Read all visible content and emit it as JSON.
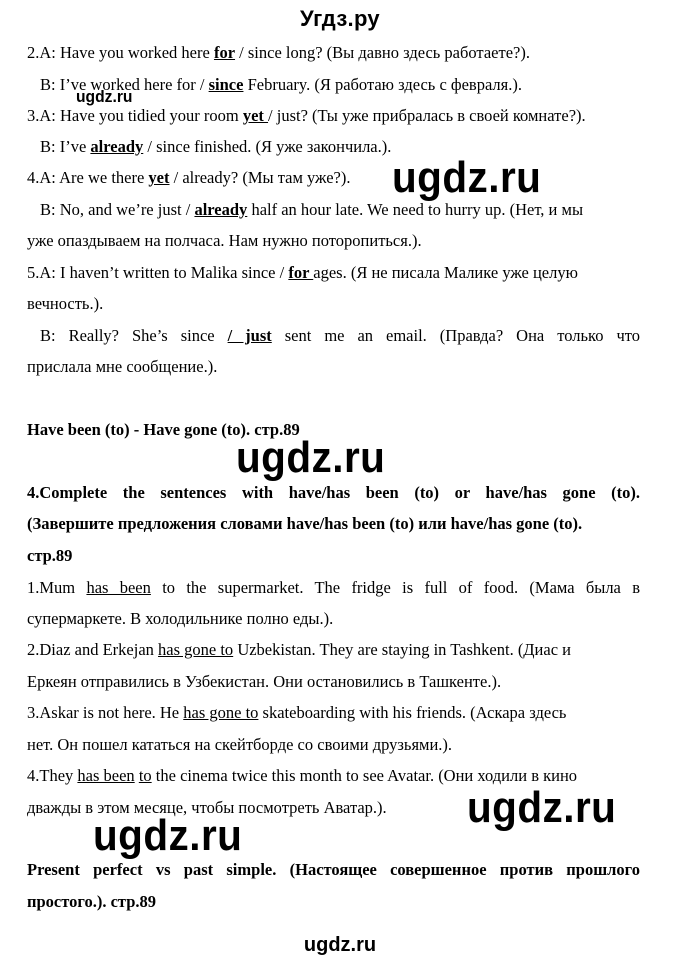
{
  "header": {
    "site_title": "Угдз.ру"
  },
  "exercise3": {
    "items": [
      {
        "a": {
          "prefix": "2.A: Have you worked here ",
          "answer": "for",
          "suffix": " / since long?  (Вы давно здесь работаете?)."
        },
        "b": {
          "prefix": "B: I’ve worked here for / ",
          "answer": "since",
          "suffix": " February. (Я работаю здесь с февраля.)."
        }
      },
      {
        "a": {
          "prefix": "3.A: Have you tidied your room ",
          "answer": "yet ",
          "suffix": "/ just? (Ты уже прибралась в своей комнате?)."
        },
        "b": {
          "prefix": "B: I’ve ",
          "answer": "already",
          "suffix": " / since finished. (Я уже закончила.)."
        }
      },
      {
        "a": {
          "prefix": "4.A: Are we there ",
          "answer": "yet",
          "suffix": " / already? (Мы там  уже?)."
        },
        "b": {
          "prefix": "B: No, and we’re just / ",
          "answer": "already",
          "suffix": " half an hour late. We need to hurry up. (Нет, и мы",
          "cont": "уже опаздываем на полчаса. Нам нужно поторопиться.)."
        }
      },
      {
        "a": {
          "prefix": "5.A: I haven’t written to Malika since / ",
          "answer": "for ",
          "suffix": "ages. (Я не писала Малике уже целую",
          "cont": "вечность.)."
        },
        "b": {
          "prefix": "B: Really? She’s since ",
          "answer": "/ just",
          "suffix": " sent me an email. (Правда? Она только что",
          "cont": "прислала мне сообщение.)."
        }
      }
    ]
  },
  "section_heading_1": "Have been (to) - Have gone (to). стр.89",
  "exercise4": {
    "title_line1": "4.Complete the sentences with have/has been (to) or have/has gone (to).",
    "title_line2": "(Завершите предложения словами have/has been (to) или have/has gone (to).",
    "title_line3": "стр.89",
    "items": [
      {
        "prefix": "1.Mum ",
        "answer": "has been",
        "suffix": " to the supermarket. The fridge is full of food. (Мама была в",
        "cont": "супермаркете. В холодильнике полно еды.)."
      },
      {
        "prefix": "2.Diaz and Erkejan ",
        "answer": "has gone to",
        "suffix": "  Uzbekistan. They are staying in Tashkent. (Диас и",
        "cont": "Еркеян отправились в Узбекистан. Они остановились в Ташкенте.)."
      },
      {
        "prefix": "3.Askar is not here. He ",
        "answer": "has gone to",
        "suffix": "  skateboarding with his friends. (Аскара здесь",
        "cont": "нет. Он пошел кататься на скейтборде со своими друзьями.)."
      },
      {
        "prefix": "4.They ",
        "answer": "has been",
        "mid": " ",
        "answer2": "to",
        "suffix": "  the cinema twice this month to see Avatar. (Они ходили в кино",
        "cont": "дважды в этом месяце, чтобы посмотреть Аватар.)."
      }
    ]
  },
  "section_heading_2": {
    "line1": "Present perfect vs past simple. (Настоящее совершенное против прошлого",
    "line2": "простого.). стр.89"
  },
  "watermarks": {
    "text": "ugdz.ru",
    "footer": "ugdz.ru"
  }
}
